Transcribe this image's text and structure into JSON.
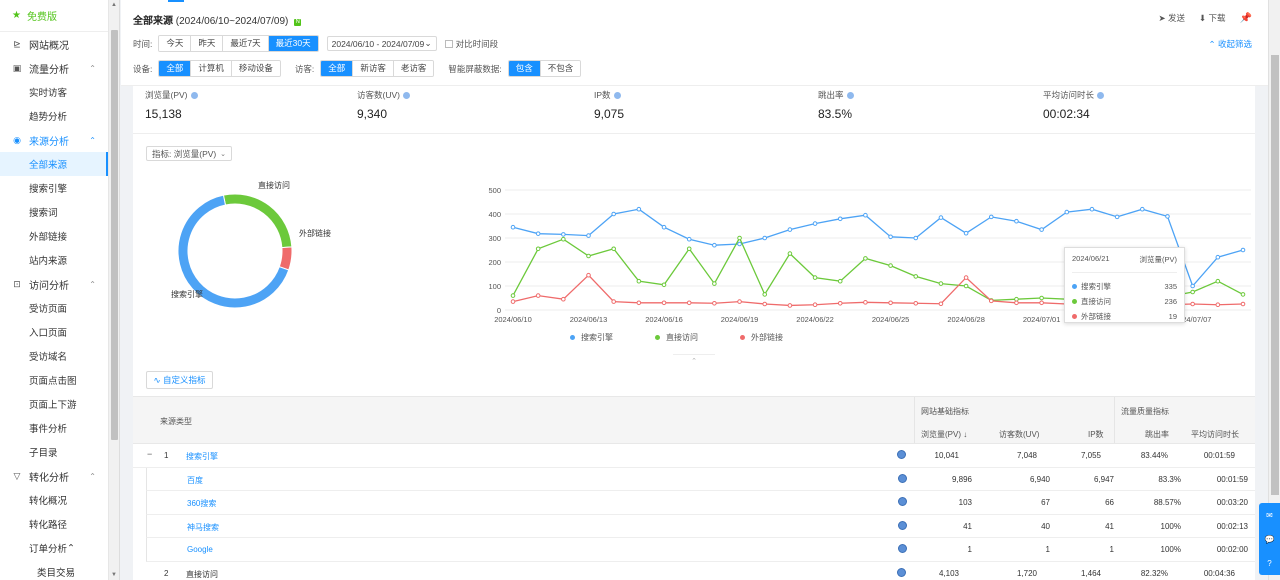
{
  "sidebar": {
    "top_label": "免费版",
    "items": [
      {
        "type": "group",
        "label": "网站概况",
        "icon": "chart-icon",
        "chevron": ""
      },
      {
        "type": "group",
        "label": "流量分析",
        "icon": "flow-icon",
        "chevron": "^"
      },
      {
        "type": "sub",
        "label": "实时访客"
      },
      {
        "type": "sub",
        "label": "趋势分析"
      },
      {
        "type": "group",
        "label": "来源分析",
        "icon": "source-icon",
        "chevron": "^",
        "active": true
      },
      {
        "type": "sub",
        "label": "全部来源",
        "active": true
      },
      {
        "type": "sub",
        "label": "搜索引擎"
      },
      {
        "type": "sub",
        "label": "搜索词"
      },
      {
        "type": "sub",
        "label": "外部链接"
      },
      {
        "type": "sub",
        "label": "站内来源"
      },
      {
        "type": "group",
        "label": "访问分析",
        "icon": "visit-icon",
        "chevron": "^"
      },
      {
        "type": "sub",
        "label": "受访页面"
      },
      {
        "type": "sub",
        "label": "入口页面"
      },
      {
        "type": "sub",
        "label": "受访域名"
      },
      {
        "type": "sub",
        "label": "页面点击图"
      },
      {
        "type": "sub",
        "label": "页面上下游"
      },
      {
        "type": "sub",
        "label": "事件分析"
      },
      {
        "type": "sub",
        "label": "子目录"
      },
      {
        "type": "group",
        "label": "转化分析",
        "icon": "funnel-icon",
        "chevron": "^"
      },
      {
        "type": "sub",
        "label": "转化概况"
      },
      {
        "type": "sub",
        "label": "转化路径"
      },
      {
        "type": "sub",
        "label": "订单分析",
        "chevron": "^"
      },
      {
        "type": "subdeep",
        "label": "类目交易"
      }
    ]
  },
  "header": {
    "title": "全部来源",
    "range": "(2024/06/10~2024/07/09)",
    "badge": "N",
    "actions": {
      "send": "发送",
      "download": "下载"
    },
    "time_label": "时间:",
    "time_options": [
      "今天",
      "昨天",
      "最近7天",
      "最近30天"
    ],
    "time_selected": 3,
    "date_range": "2024/06/10 - 2024/07/09",
    "compare_label": "对比时间段",
    "collapse_label": "收起筛选",
    "device_label": "设备:",
    "device_options": [
      "全部",
      "计算机",
      "移动设备"
    ],
    "visitor_label": "访客:",
    "visitor_options": [
      "全部",
      "新访客",
      "老访客"
    ],
    "smart_label": "智能屏蔽数据:",
    "smart_options": [
      "包含",
      "不包含"
    ]
  },
  "stats": [
    {
      "label": "浏览量(PV)",
      "value": "15,138"
    },
    {
      "label": "访客数(UV)",
      "value": "9,340"
    },
    {
      "label": "IP数",
      "value": "9,075"
    },
    {
      "label": "跳出率",
      "value": "83.5%"
    },
    {
      "label": "平均访问时长",
      "value": "00:02:34"
    }
  ],
  "metric_selector": {
    "label": "指标:",
    "value": "浏览量(PV)"
  },
  "colors": {
    "search": "#4da3f5",
    "direct": "#6cc93b",
    "external": "#ef6b6b",
    "accent": "#1890ff"
  },
  "chart_data": [
    {
      "type": "pie",
      "categories": [
        "搜索引擎",
        "直接访问",
        "外部链接"
      ],
      "values": [
        10041,
        4103,
        994
      ]
    },
    {
      "type": "line",
      "x": [
        "2024/06/10",
        "2024/06/11",
        "2024/06/12",
        "2024/06/13",
        "2024/06/14",
        "2024/06/15",
        "2024/06/16",
        "2024/06/17",
        "2024/06/18",
        "2024/06/19",
        "2024/06/20",
        "2024/06/21",
        "2024/06/22",
        "2024/06/23",
        "2024/06/24",
        "2024/06/25",
        "2024/06/26",
        "2024/06/27",
        "2024/06/28",
        "2024/06/29",
        "2024/06/30",
        "2024/07/01",
        "2024/07/02",
        "2024/07/03",
        "2024/07/04",
        "2024/07/05",
        "2024/07/06",
        "2024/07/07",
        "2024/07/08",
        "2024/07/09"
      ],
      "x_ticks": [
        "2024/06/10",
        "2024/06/13",
        "2024/06/16",
        "2024/06/19",
        "2024/06/22",
        "2024/06/25",
        "2024/06/28",
        "2024/07/01",
        "2024/07/04",
        "2024/07/07"
      ],
      "ylim": [
        0,
        500
      ],
      "y_ticks": [
        "0",
        "100",
        "200",
        "300",
        "400",
        "500"
      ],
      "series": [
        {
          "name": "搜索引擎",
          "values": [
            345,
            318,
            315,
            310,
            400,
            420,
            345,
            295,
            270,
            275,
            300,
            335,
            360,
            380,
            395,
            305,
            300,
            385,
            320,
            388,
            370,
            335,
            408,
            420,
            388,
            420,
            390,
            100,
            220,
            250
          ]
        },
        {
          "name": "直接访问",
          "values": [
            60,
            255,
            295,
            225,
            255,
            120,
            105,
            255,
            110,
            300,
            65,
            235,
            135,
            120,
            215,
            185,
            140,
            110,
            100,
            40,
            45,
            50,
            45,
            45,
            50,
            60,
            55,
            75,
            120,
            65
          ]
        },
        {
          "name": "外部链接",
          "values": [
            35,
            60,
            45,
            145,
            35,
            30,
            30,
            30,
            28,
            35,
            25,
            19,
            22,
            28,
            32,
            30,
            28,
            26,
            135,
            38,
            30,
            30,
            25,
            28,
            25,
            22,
            22,
            25,
            22,
            25
          ]
        }
      ],
      "grid": true,
      "legend": "bottom"
    }
  ],
  "tooltip": {
    "date": "2024/06/21",
    "metric": "浏览量(PV)",
    "rows": [
      {
        "name": "搜索引擎",
        "value": "335"
      },
      {
        "name": "直接访问",
        "value": "236"
      },
      {
        "name": "外部链接",
        "value": "19"
      }
    ]
  },
  "legend": [
    "搜索引擎",
    "直接访问",
    "外部链接"
  ],
  "custom_metric_label": "自定义指标",
  "table": {
    "source_header": "来源类型",
    "group1": "网站基础指标",
    "group2": "流量质量指标",
    "cols": [
      "浏览量(PV)",
      "访客数(UV)",
      "IP数",
      "跳出率",
      "平均访问时长"
    ],
    "sort_mark": "↓",
    "rows": [
      {
        "toggle": "−",
        "index": "1",
        "name": "搜索引擎",
        "link": true,
        "pv": "10,041",
        "uv": "7,048",
        "ip": "7,055",
        "bounce": "83.44%",
        "dur": "00:01:59",
        "child": false
      },
      {
        "toggle": "",
        "index": "",
        "name": "百度",
        "link": true,
        "pv": "9,896",
        "uv": "6,940",
        "ip": "6,947",
        "bounce": "83.3%",
        "dur": "00:01:59",
        "child": true
      },
      {
        "toggle": "",
        "index": "",
        "name": "360搜索",
        "link": true,
        "pv": "103",
        "uv": "67",
        "ip": "66",
        "bounce": "88.57%",
        "dur": "00:03:20",
        "child": true
      },
      {
        "toggle": "",
        "index": "",
        "name": "神马搜索",
        "link": true,
        "pv": "41",
        "uv": "40",
        "ip": "41",
        "bounce": "100%",
        "dur": "00:02:13",
        "child": true
      },
      {
        "toggle": "",
        "index": "",
        "name": "Google",
        "link": true,
        "pv": "1",
        "uv": "1",
        "ip": "1",
        "bounce": "100%",
        "dur": "00:02:00",
        "child": true
      },
      {
        "toggle": "",
        "index": "2",
        "name": "直接访问",
        "link": false,
        "pv": "4,103",
        "uv": "1,720",
        "ip": "1,464",
        "bounce": "82.32%",
        "dur": "00:04:36",
        "child": false
      }
    ]
  }
}
